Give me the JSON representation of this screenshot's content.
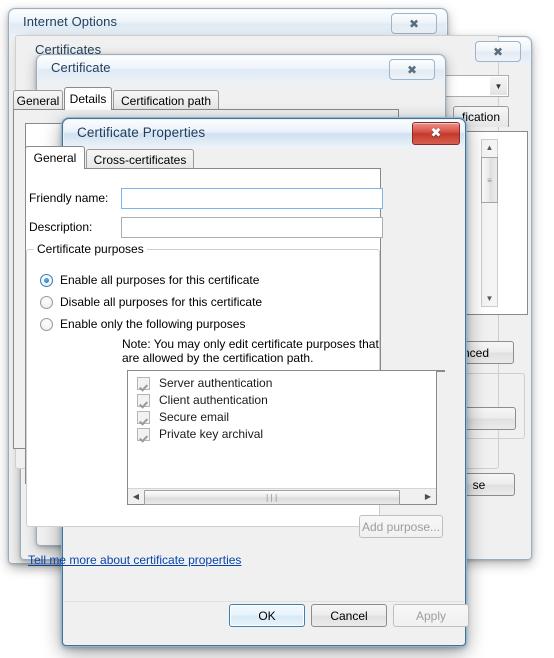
{
  "windows": {
    "internet_options": {
      "title": "Internet Options",
      "close_glyph": "✖"
    },
    "certificates": {
      "title": "Certificates",
      "close_glyph": "✖",
      "close_button_label": "se"
    },
    "certificate": {
      "title": "Certificate",
      "close_glyph": "✖",
      "tabs": [
        {
          "label": "General",
          "selected": false
        },
        {
          "label": "Details",
          "selected": true
        },
        {
          "label": "Certification path",
          "selected": false
        }
      ],
      "partial_tab_label": "fication",
      "advanced_button_label": "nced"
    }
  },
  "dialog": {
    "title": "Certificate Properties",
    "close_glyph": "✖",
    "tabs": [
      {
        "label": "General",
        "selected": true
      },
      {
        "label": "Cross-certificates",
        "selected": false
      }
    ],
    "fields": [
      {
        "label": "Friendly name:",
        "value": "",
        "placeholder": "",
        "focused": true
      },
      {
        "label": "Description:",
        "value": "",
        "placeholder": "",
        "focused": false
      }
    ],
    "purposes_group": {
      "legend": "Certificate purposes",
      "radios": [
        {
          "label": "Enable all purposes for this certificate",
          "selected": true
        },
        {
          "label": "Disable all purposes for this certificate",
          "selected": false
        },
        {
          "label": "Enable only the following purposes",
          "selected": false
        }
      ],
      "note": "Note: You may only edit certificate purposes that are allowed by the certification path.",
      "list": [
        {
          "label": "Server authentication",
          "checked": true
        },
        {
          "label": "Client authentication",
          "checked": true
        },
        {
          "label": "Secure email",
          "checked": true
        },
        {
          "label": "Private key archival",
          "checked": true
        }
      ],
      "scrollbar": {
        "left_glyph": "◀",
        "right_glyph": "▶",
        "grip": "∣∣∣"
      },
      "add_purpose_button": {
        "label": "Add purpose...",
        "disabled": true
      }
    },
    "help_link": "Tell me more about certificate properties",
    "buttons": [
      {
        "label": "OK",
        "style": "default",
        "disabled": false
      },
      {
        "label": "Cancel",
        "style": "normal",
        "disabled": false
      },
      {
        "label": "Apply",
        "style": "normal",
        "disabled": true
      }
    ]
  },
  "colors": {
    "dialog_face": "#f0f0f0",
    "close_red": "#c33a2c",
    "focus_blue": "#7eb4ea",
    "link_blue": "#0645ad",
    "active_border": "#4d6f8e"
  }
}
